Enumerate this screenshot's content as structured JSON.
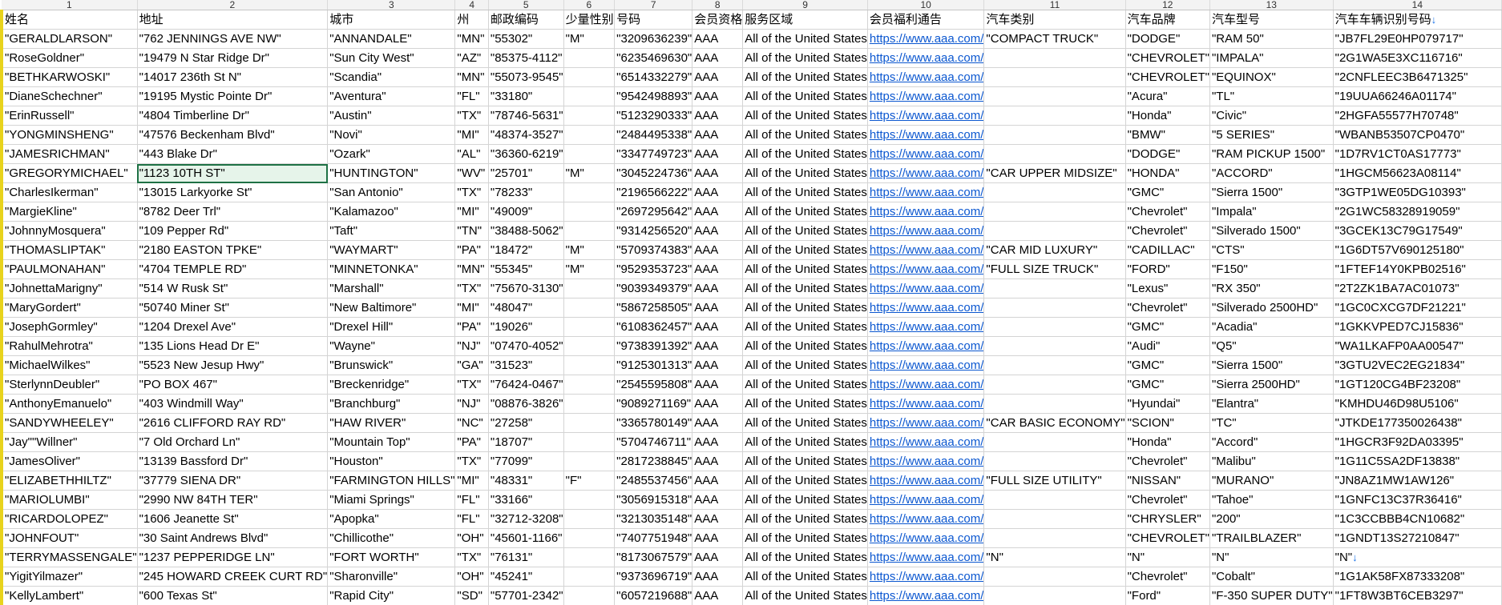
{
  "colors": {
    "link": "#0b57d0",
    "selection": "#1e7145",
    "left_marker": "#e8d31c"
  },
  "icons": {
    "arrow": "down-arrow-icon"
  },
  "column_numbers": [
    "1",
    "2",
    "3",
    "4",
    "5",
    "6",
    "7",
    "8",
    "9",
    "10",
    "11",
    "12",
    "13",
    "14"
  ],
  "headers": [
    "姓名",
    "地址",
    "城市",
    "州",
    "邮政编码",
    "少量性别",
    "号码",
    "会员资格",
    "服务区域",
    "会员福利通告",
    "汽车类别",
    "汽车品牌",
    "汽车型号",
    "汽车车辆识别号码↓"
  ],
  "rows": [
    [
      "\"GERALDLARSON\"",
      "\"762 JENNINGS AVE NW\"",
      "\"ANNANDALE\"",
      "\"MN\"",
      "\"55302\"",
      "\"M\"",
      "\"3209636239\"",
      "AAA",
      "All of the United States",
      "https://www.aaa.com/",
      "\"COMPACT TRUCK\"",
      "\"DODGE\"",
      "\"RAM 50\"",
      "\"JB7FL29E0HP079717\""
    ],
    [
      "\"RoseGoldner\"",
      "\"19479 N Star Ridge Dr\"",
      "\"Sun City West\"",
      "\"AZ\"",
      "\"85375-4112\"",
      "",
      "\"6235469630\"",
      "AAA",
      "All of the United States",
      "https://www.aaa.com/",
      "",
      "\"CHEVROLET\"",
      "\"IMPALA\"",
      "\"2G1WA5E3XC116716\""
    ],
    [
      "\"BETHKARWOSKI\"",
      "\"14017 236th St N\"",
      "\"Scandia\"",
      "\"MN\"",
      "\"55073-9545\"",
      "",
      "\"6514332279\"",
      "AAA",
      "All of the United States",
      "https://www.aaa.com/",
      "",
      "\"CHEVROLET\"",
      "\"EQUINOX\"",
      "\"2CNFLEEC3B6471325\""
    ],
    [
      "\"DianeSchechner\"",
      "\"19195 Mystic Pointe Dr\"",
      "\"Aventura\"",
      "\"FL\"",
      "\"33180\"",
      "",
      "\"9542498893\"",
      "AAA",
      "All of the United States",
      "https://www.aaa.com/",
      "",
      "\"Acura\"",
      "\"TL\"",
      "\"19UUA66246A01174\""
    ],
    [
      "\"ErinRussell\"",
      "\"4804 Timberline Dr\"",
      "\"Austin\"",
      "\"TX\"",
      "\"78746-5631\"",
      "",
      "\"5123290333\"",
      "AAA",
      "All of the United States",
      "https://www.aaa.com/",
      "",
      "\"Honda\"",
      "\"Civic\"",
      "\"2HGFA55577H70748\""
    ],
    [
      "\"YONGMINSHENG\"",
      "\"47576 Beckenham Blvd\"",
      "\"Novi\"",
      "\"MI\"",
      "\"48374-3527\"",
      "",
      "\"2484495338\"",
      "AAA",
      "All of the United States",
      "https://www.aaa.com/",
      "",
      "\"BMW\"",
      "\"5 SERIES\"",
      "\"WBANB53507CP0470\""
    ],
    [
      "\"JAMESRICHMAN\"",
      "\"443 Blake Dr\"",
      "\"Ozark\"",
      "\"AL\"",
      "\"36360-6219\"",
      "",
      "\"3347749723\"",
      "AAA",
      "All of the United States",
      "https://www.aaa.com/",
      "",
      "\"DODGE\"",
      "\"RAM PICKUP 1500\"",
      "\"1D7RV1CT0AS17773\""
    ],
    [
      "\"GREGORYMICHAEL\"",
      "\"1123 10TH ST\"",
      "\"HUNTINGTON\"",
      "\"WV\"",
      "\"25701\"",
      "\"M\"",
      "\"3045224736\"",
      "AAA",
      "All of the United States",
      "https://www.aaa.com/",
      "\"CAR UPPER MIDSIZE\"",
      "\"HONDA\"",
      "\"ACCORD\"",
      "\"1HGCM56623A08114\""
    ],
    [
      "\"CharlesIkerman\"",
      "\"13015 Larkyorke St\"",
      "\"San Antonio\"",
      "\"TX\"",
      "\"78233\"",
      "",
      "\"2196566222\"",
      "AAA",
      "All of the United States",
      "https://www.aaa.com/",
      "",
      "\"GMC\"",
      "\"Sierra 1500\"",
      "\"3GTP1WE05DG10393\""
    ],
    [
      "\"MargieKline\"",
      "\"8782 Deer Trl\"",
      "\"Kalamazoo\"",
      "\"MI\"",
      "\"49009\"",
      "",
      "\"2697295642\"",
      "AAA",
      "All of the United States",
      "https://www.aaa.com/",
      "",
      "\"Chevrolet\"",
      "\"Impala\"",
      "\"2G1WC58328919059\""
    ],
    [
      "\"JohnnyMosquera\"",
      "\"109 Pepper Rd\"",
      "\"Taft\"",
      "\"TN\"",
      "\"38488-5062\"",
      "",
      "\"9314256520\"",
      "AAA",
      "All of the United States",
      "https://www.aaa.com/",
      "",
      "\"Chevrolet\"",
      "\"Silverado 1500\"",
      "\"3GCEK13C79G17549\""
    ],
    [
      "\"THOMASLIPTAK\"",
      "\"2180 EASTON TPKE\"",
      "\"WAYMART\"",
      "\"PA\"",
      "\"18472\"",
      "\"M\"",
      "\"5709374383\"",
      "AAA",
      "All of the United States",
      "https://www.aaa.com/",
      "\"CAR MID LUXURY\"",
      "\"CADILLAC\"",
      "\"CTS\"",
      "\"1G6DT57V690125180\""
    ],
    [
      "\"PAULMONAHAN\"",
      "\"4704 TEMPLE RD\"",
      "\"MINNETONKA\"",
      "\"MN\"",
      "\"55345\"",
      "\"M\"",
      "\"9529353723\"",
      "AAA",
      "All of the United States",
      "https://www.aaa.com/",
      "\"FULL SIZE TRUCK\"",
      "\"FORD\"",
      "\"F150\"",
      "\"1FTEF14Y0KPB02516\""
    ],
    [
      "\"JohnettaMarigny\"",
      "\"514 W Rusk St\"",
      "\"Marshall\"",
      "\"TX\"",
      "\"75670-3130\"",
      "",
      "\"9039349379\"",
      "AAA",
      "All of the United States",
      "https://www.aaa.com/",
      "",
      "\"Lexus\"",
      "\"RX 350\"",
      "\"2T2ZK1BA7AC01073\""
    ],
    [
      "\"MaryGordert\"",
      "\"50740 Miner St\"",
      "\"New Baltimore\"",
      "\"MI\"",
      "\"48047\"",
      "",
      "\"5867258505\"",
      "AAA",
      "All of the United States",
      "https://www.aaa.com/",
      "",
      "\"Chevrolet\"",
      "\"Silverado 2500HD\"",
      "\"1GC0CXCG7DF21221\""
    ],
    [
      "\"JosephGormley\"",
      "\"1204 Drexel Ave\"",
      "\"Drexel Hill\"",
      "\"PA\"",
      "\"19026\"",
      "",
      "\"6108362457\"",
      "AAA",
      "All of the United States",
      "https://www.aaa.com/",
      "",
      "\"GMC\"",
      "\"Acadia\"",
      "\"1GKKVPED7CJ15836\""
    ],
    [
      "\"RahulMehrotra\"",
      "\"135 Lions Head Dr E\"",
      "\"Wayne\"",
      "\"NJ\"",
      "\"07470-4052\"",
      "",
      "\"9738391392\"",
      "AAA",
      "All of the United States",
      "https://www.aaa.com/",
      "",
      "\"Audi\"",
      "\"Q5\"",
      "\"WA1LKAFP0AA00547\""
    ],
    [
      "\"MichaelWilkes\"",
      "\"5523 New Jesup Hwy\"",
      "\"Brunswick\"",
      "\"GA\"",
      "\"31523\"",
      "",
      "\"9125301313\"",
      "AAA",
      "All of the United States",
      "https://www.aaa.com/",
      "",
      "\"GMC\"",
      "\"Sierra 1500\"",
      "\"3GTU2VEC2EG21834\""
    ],
    [
      "\"SterlynnDeubler\"",
      "\"PO BOX 467\"",
      "\"Breckenridge\"",
      "\"TX\"",
      "\"76424-0467\"",
      "",
      "\"2545595808\"",
      "AAA",
      "All of the United States",
      "https://www.aaa.com/",
      "",
      "\"GMC\"",
      "\"Sierra 2500HD\"",
      "\"1GT120CG4BF23208\""
    ],
    [
      "\"AnthonyEmanuelo\"",
      "\"403 Windmill Way\"",
      "\"Branchburg\"",
      "\"NJ\"",
      "\"08876-3826\"",
      "",
      "\"9089271169\"",
      "AAA",
      "All of the United States",
      "https://www.aaa.com/",
      "",
      "\"Hyundai\"",
      "\"Elantra\"",
      "\"KMHDU46D98U5106\""
    ],
    [
      "\"SANDYWHEELEY\"",
      "\"2616 CLIFFORD RAY RD\"",
      "\"HAW RIVER\"",
      "\"NC\"",
      "\"27258\"",
      "",
      "\"3365780149\"",
      "AAA",
      "All of the United States",
      "https://www.aaa.com/",
      "\"CAR BASIC ECONOMY\"",
      "\"SCION\"",
      "\"TC\"",
      "\"JTKDE177350026438\""
    ],
    [
      "\"Jay\"\"Willner\"",
      "\"7 Old Orchard Ln\"",
      "\"Mountain Top\"",
      "\"PA\"",
      "\"18707\"",
      "",
      "\"5704746711\"",
      "AAA",
      "All of the United States",
      "https://www.aaa.com/",
      "",
      "\"Honda\"",
      "\"Accord\"",
      "\"1HGCR3F92DA03395\""
    ],
    [
      "\"JamesOliver\"",
      "\"13139 Bassford Dr\"",
      "\"Houston\"",
      "\"TX\"",
      "\"77099\"",
      "",
      "\"2817238845\"",
      "AAA",
      "All of the United States",
      "https://www.aaa.com/",
      "",
      "\"Chevrolet\"",
      "\"Malibu\"",
      "\"1G11C5SA2DF13838\""
    ],
    [
      "\"ELIZABETHHILTZ\"",
      "\"37779 SIENA DR\"",
      "\"FARMINGTON HILLS\"",
      "\"MI\"",
      "\"48331\"",
      "\"F\"",
      "\"2485537456\"",
      "AAA",
      "All of the United States",
      "https://www.aaa.com/",
      "\"FULL SIZE UTILITY\"",
      "\"NISSAN\"",
      "\"MURANO\"",
      "\"JN8AZ1MW1AW126\""
    ],
    [
      "\"MARIOLUMBI\"",
      "\"2990 NW 84TH TER\"",
      "\"Miami Springs\"",
      "\"FL\"",
      "\"33166\"",
      "",
      "\"3056915318\"",
      "AAA",
      "All of the United States",
      "https://www.aaa.com/",
      "",
      "\"Chevrolet\"",
      "\"Tahoe\"",
      "\"1GNFC13C37R36416\""
    ],
    [
      "\"RICARDOLOPEZ\"",
      "\"1606 Jeanette St\"",
      "\"Apopka\"",
      "\"FL\"",
      "\"32712-3208\"",
      "",
      "\"3213035148\"",
      "AAA",
      "All of the United States",
      "https://www.aaa.com/",
      "",
      "\"CHRYSLER\"",
      "\"200\"",
      "\"1C3CCBBB4CN10682\""
    ],
    [
      "\"JOHNFOUT\"",
      "\"30 Saint Andrews Blvd\"",
      "\"Chillicothe\"",
      "\"OH\"",
      "\"45601-1166\"",
      "",
      "\"7407751948\"",
      "AAA",
      "All of the United States",
      "https://www.aaa.com/",
      "",
      "\"CHEVROLET\"",
      "\"TRAILBLAZER\"",
      "\"1GNDT13S27210847\""
    ],
    [
      "\"TERRYMASSENGALE\"",
      "\"1237 PEPPERIDGE LN\"",
      "\"FORT WORTH\"",
      "\"TX\"",
      "\"76131\"",
      "",
      "\"8173067579\"",
      "AAA",
      "All of the United States",
      "https://www.aaa.com/",
      "\"N\"",
      "\"N\"",
      "\"N\"",
      "\"N\"↓"
    ],
    [
      "\"YigitYilmazer\"",
      "\"245 HOWARD CREEK CURT RD\"",
      "\"Sharonville\"",
      "\"OH\"",
      "\"45241\"",
      "",
      "\"9373696719\"",
      "AAA",
      "All of the United States",
      "https://www.aaa.com/",
      "",
      "\"Chevrolet\"",
      "\"Cobalt\"",
      "\"1G1AK58FX87333208\""
    ],
    [
      "\"KellyLambert\"",
      "\"600 Texas St\"",
      "\"Rapid City\"",
      "\"SD\"",
      "\"57701-2342\"",
      "",
      "\"6057219688\"",
      "AAA",
      "All of the United States",
      "https://www.aaa.com/",
      "",
      "\"Ford\"",
      "\"F-350 SUPER DUTY\"",
      "\"1FT8W3BT6CEB3297\""
    ]
  ]
}
